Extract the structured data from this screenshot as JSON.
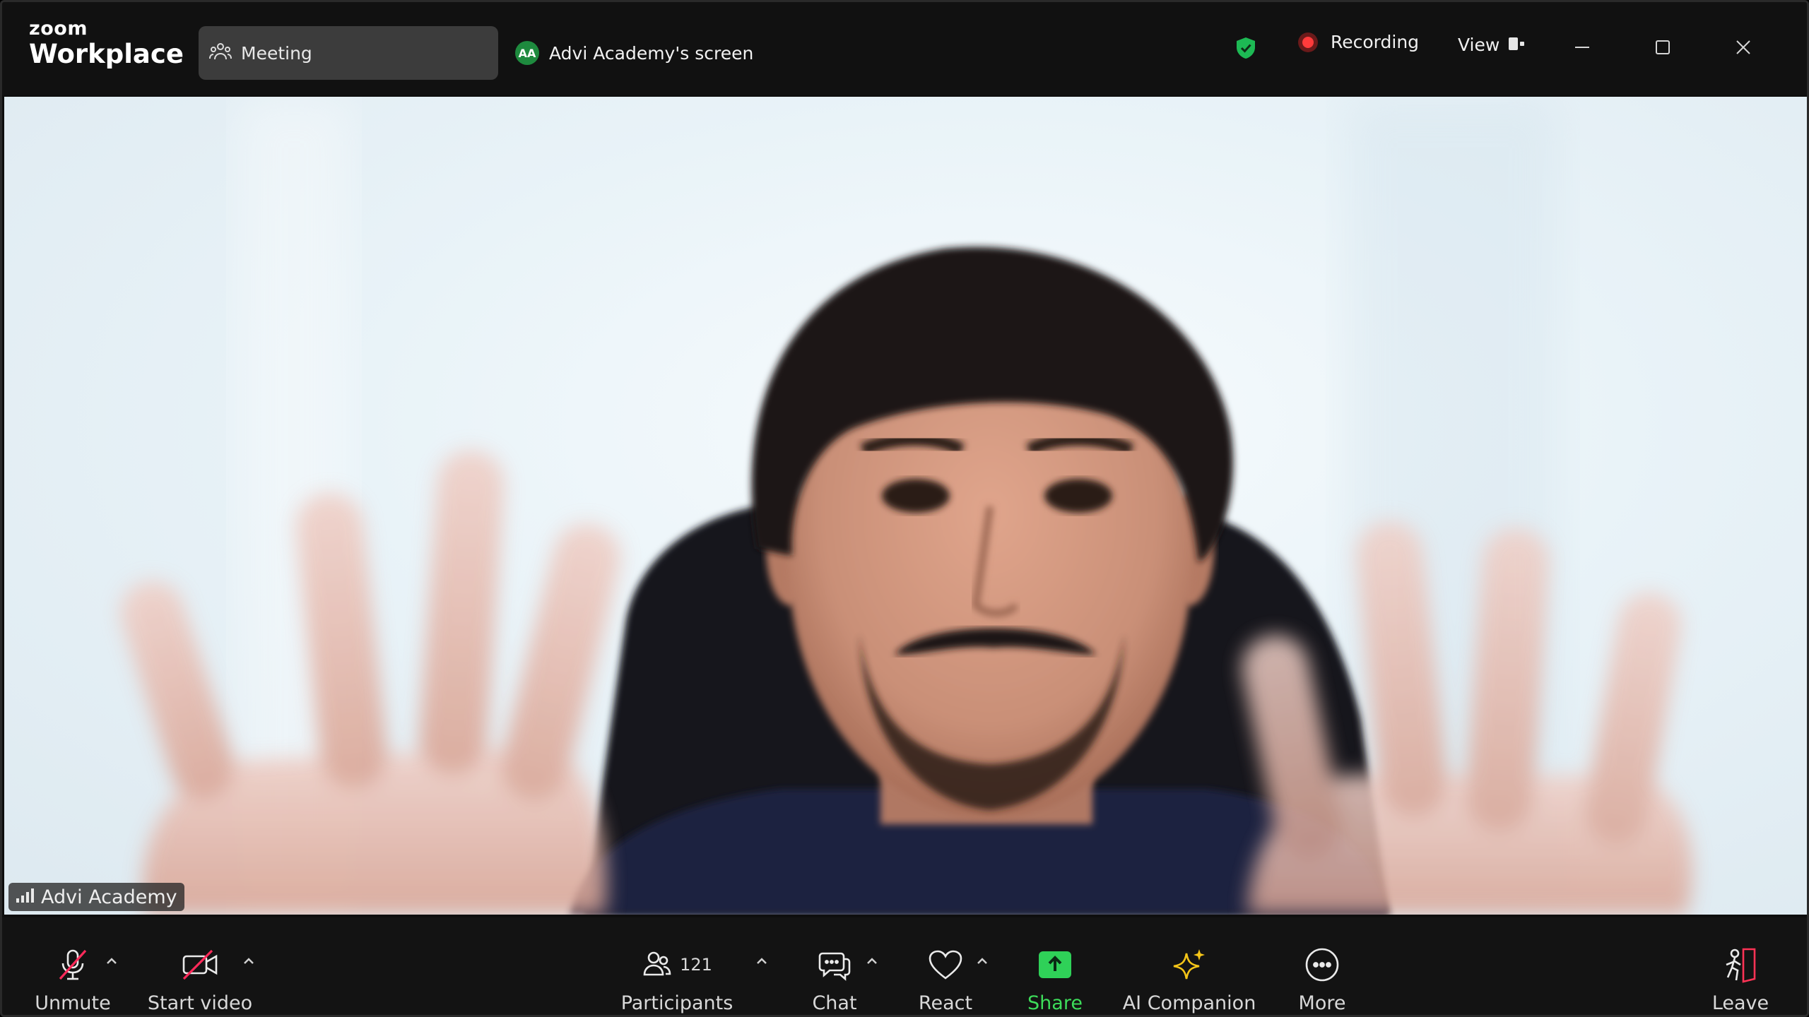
{
  "app": {
    "logo_line1": "zoom",
    "logo_line2": "Workplace"
  },
  "titlebar": {
    "meeting_tab": "Meeting",
    "screen_tab": {
      "initials": "AA",
      "label": "Advi Academy's screen"
    },
    "recording_label": "Recording",
    "view_label": "View",
    "icons": [
      "meeting-icon",
      "encryption-shield-icon",
      "recording-icon",
      "view-layout-icon",
      "minimize-icon",
      "maximize-icon",
      "close-icon"
    ]
  },
  "video": {
    "participant_name": "Advi Academy"
  },
  "toolbar": {
    "unmute": "Unmute",
    "start_video": "Start video",
    "participants": "Participants",
    "participants_count": "121",
    "chat": "Chat",
    "react": "React",
    "share": "Share",
    "ai_companion": "AI Companion",
    "more": "More",
    "leave": "Leave"
  },
  "colors": {
    "share_green": "#3ddc5a",
    "muted_red": "#ff2a5a",
    "ai_star": "#f5c518",
    "leave_red": "#ff3355",
    "recording_red": "#ff3b3b",
    "shield_green": "#1db954"
  }
}
